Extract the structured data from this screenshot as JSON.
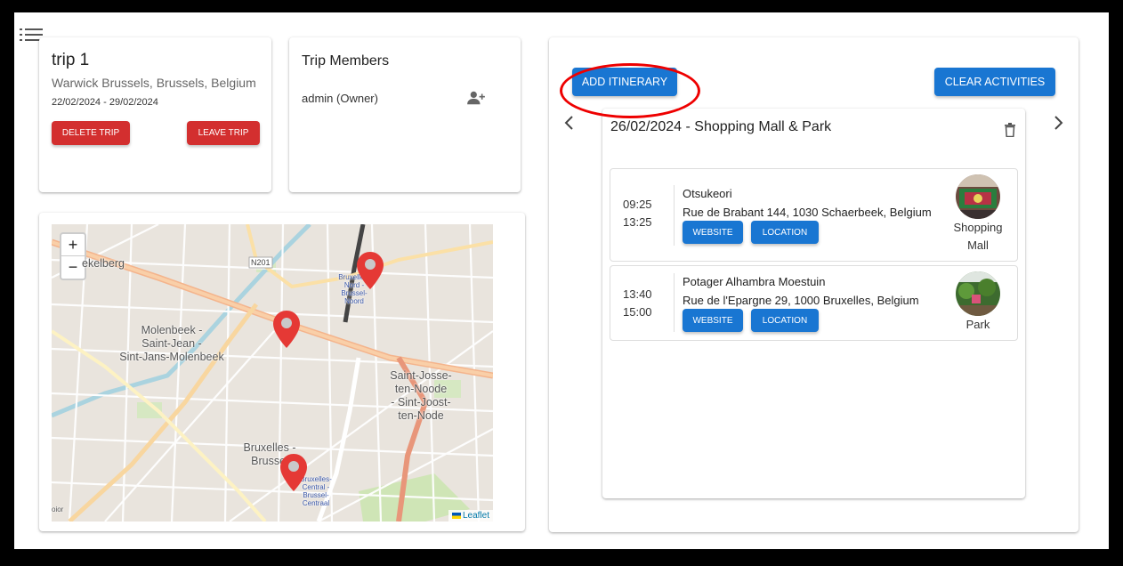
{
  "trip": {
    "title": "trip 1",
    "location": "Warwick Brussels, Brussels, Belgium",
    "dates": "22/02/2024 - 29/02/2024",
    "delete_label": "DELETE TRIP",
    "leave_label": "LEAVE TRIP"
  },
  "members": {
    "title": "Trip Members",
    "items": [
      {
        "name": "admin (Owner)",
        "icon": "add-member-icon"
      }
    ]
  },
  "map": {
    "zoom_in": "+",
    "zoom_out": "−",
    "labels": {
      "koekelberg": "ekelberg",
      "n201": "N201",
      "molenbeek_1": "Molenbeek -",
      "molenbeek_2": "Saint-Jean -",
      "molenbeek_3": "Sint-Jans-Molenbeek",
      "stjosse_1": "Saint-Josse-",
      "stjosse_2": "ten-Noode",
      "stjosse_3": "- Sint-Joost-",
      "stjosse_4": "ten-Node",
      "bxl_1": "Bruxelles -",
      "bxl_2": "Brussel",
      "nord_1": "Bruxelles-",
      "nord_2": "Nord -",
      "nord_3": "Brussel-",
      "nord_4": "Noord",
      "central_1": "Bruxelles-",
      "central_2": "Central -",
      "central_3": "Brussel-",
      "central_4": "Centraal",
      "edge": "oior"
    },
    "attribution": "Leaflet",
    "accent": "#e53935"
  },
  "itinerary": {
    "add_label": "ADD ITINERARY",
    "clear_label": "CLEAR ACTIVITIES",
    "day_title": "26/02/2024 - Shopping Mall & Park",
    "activities": [
      {
        "start": "09:25",
        "end": "13:25",
        "name": "Otsukeori",
        "address": "Rue de Brabant 144, 1030 Schaerbeek, Belgium",
        "website_label": "WEBSITE",
        "location_label": "LOCATION",
        "category_1": "Shopping",
        "category_2": "Mall"
      },
      {
        "start": "13:40",
        "end": "15:00",
        "name": "Potager Alhambra Moestuin",
        "address": "Rue de l'Epargne 29, 1000 Bruxelles, Belgium",
        "website_label": "WEBSITE",
        "location_label": "LOCATION",
        "category_1": "Park"
      }
    ]
  },
  "colors": {
    "primary": "#1976d2",
    "danger": "#d32f2f",
    "highlight": "#e00000"
  }
}
